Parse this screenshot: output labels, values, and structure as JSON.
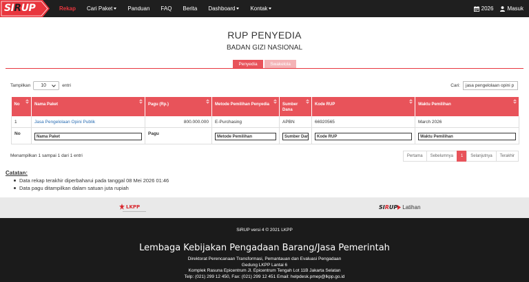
{
  "brand": {
    "logo_text_a": "SI",
    "logo_text_r": "R",
    "logo_text_b": "UP"
  },
  "nav": {
    "items": [
      {
        "label": "Rekap",
        "active": true,
        "dropdown": false
      },
      {
        "label": "Cari Paket",
        "active": false,
        "dropdown": true
      },
      {
        "label": "Panduan",
        "active": false,
        "dropdown": false
      },
      {
        "label": "FAQ",
        "active": false,
        "dropdown": false
      },
      {
        "label": "Berita",
        "active": false,
        "dropdown": false
      },
      {
        "label": "Dashboard",
        "active": false,
        "dropdown": true
      },
      {
        "label": "Kontak",
        "active": false,
        "dropdown": true
      }
    ],
    "year": "2026",
    "login": "Masuk"
  },
  "header": {
    "title": "RUP PENYEDIA",
    "subtitle": "BADAN GIZI NASIONAL"
  },
  "tabs": {
    "penyedia": "Penyedia",
    "swakelola": "Swakelola"
  },
  "table_controls": {
    "show_label": "Tampilkan",
    "entries_value": "10",
    "entries_label": "entri",
    "search_label": "Cari:",
    "search_value": "jasa pengelolaan opini p"
  },
  "table": {
    "columns": [
      "No",
      "Nama Paket",
      "Pagu (Rp.)",
      "Metode Pemilihan Penyedia",
      "Sumber Dana",
      "Kode RUP",
      "Waktu Pemilihan"
    ],
    "rows": [
      {
        "no": "1",
        "nama": "Jasa Pengelolaan Opini Publik",
        "pagu": "800.000.000",
        "metode": "E-Purchasing",
        "sumber": "APBN",
        "kode": "66920565",
        "waktu": "March 2026"
      }
    ],
    "filter": {
      "no": "No",
      "nama": "Nama Paket",
      "pagu": "Pagu",
      "metode": "Metode Pemilihan",
      "sumber": "Sumber Dan",
      "kode": "Kode RUP",
      "waktu": "Waktu Pemilihan"
    }
  },
  "info": "Menampilkan 1 sampai 1 dari 1 entri",
  "pagination": {
    "first": "Pertama",
    "prev": "Sebelumnya",
    "current": "1",
    "next": "Selanjutnya",
    "last": "Terakhir"
  },
  "notes": {
    "title": "Catatan:",
    "items": [
      "Data rekap terakhir diperbaharui pada tanggal 08 Mei 2026 01:46",
      "Data pagu ditampilkan dalam satuan juta rupiah"
    ]
  },
  "partners": {
    "lkpp": "LKPP",
    "sirup_a": "SI",
    "sirup_r": "R",
    "sirup_b": "UP",
    "latihan": "Latihan"
  },
  "footer": {
    "version": "SiRUP versi 4 © 2021 LKPP",
    "org": "Lembaga Kebijakan Pengadaan Barang/Jasa Pemerintah",
    "lines": [
      "Direktorat Perencanaan Transformasi, Pemantauan dan Evaluasi Pengadaan",
      "Gedung LKPP Lantai 6",
      "Komplek Rasuna Epicentrum Jl. Epicentrum Tengah Lot 11B Jakarta Selatan",
      "Telp: (021) 299 12 450, Fax: (021) 299 12 451 Email: helpdesk.pmep@lkpp.go.id"
    ]
  },
  "colors": {
    "accent": "#e8535a",
    "nav_bg": "#1f1f1f",
    "footer_bg": "#1b1b1b",
    "link": "#2a6db3"
  }
}
